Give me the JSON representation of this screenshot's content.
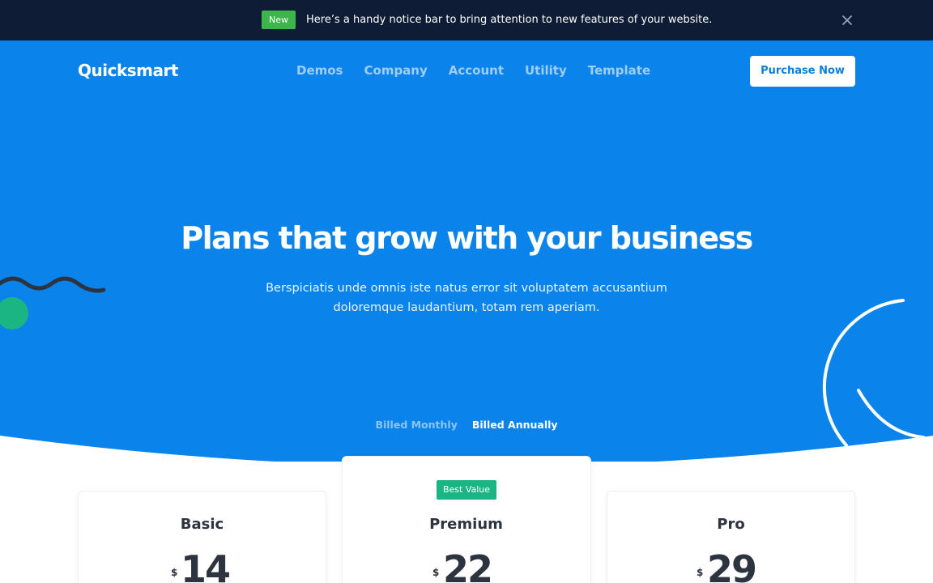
{
  "notice": {
    "badge": "New",
    "text": "Here’s a handy notice bar to bring attention to new features of your website.",
    "close_icon": "close-icon"
  },
  "header": {
    "logo": "Quicksmart",
    "nav": [
      "Demos",
      "Company",
      "Account",
      "Utility",
      "Template"
    ],
    "cta": "Purchase Now"
  },
  "hero": {
    "title": "Plans that grow with your business",
    "subtitle_line1": "Berspiciatis unde omnis iste natus error sit voluptatem accusantium",
    "subtitle_line2": "doloremque laudantium, totam rem aperiam."
  },
  "billing": {
    "monthly": "Billed Monthly",
    "annually": "Billed Annually",
    "selected": "Billed Annually"
  },
  "plans": [
    {
      "name": "Basic",
      "currency": "$",
      "price": "14"
    },
    {
      "name": "Premium",
      "currency": "$",
      "price": "22",
      "badge": "Best Value"
    },
    {
      "name": "Pro",
      "currency": "$",
      "price": "29"
    }
  ],
  "colors": {
    "notice_bg": "#0f1c35",
    "hero_bg": "#0a84ea",
    "new_badge": "#3cb54a",
    "best_value_badge": "#1ab582",
    "dark_text": "#2d3440"
  }
}
